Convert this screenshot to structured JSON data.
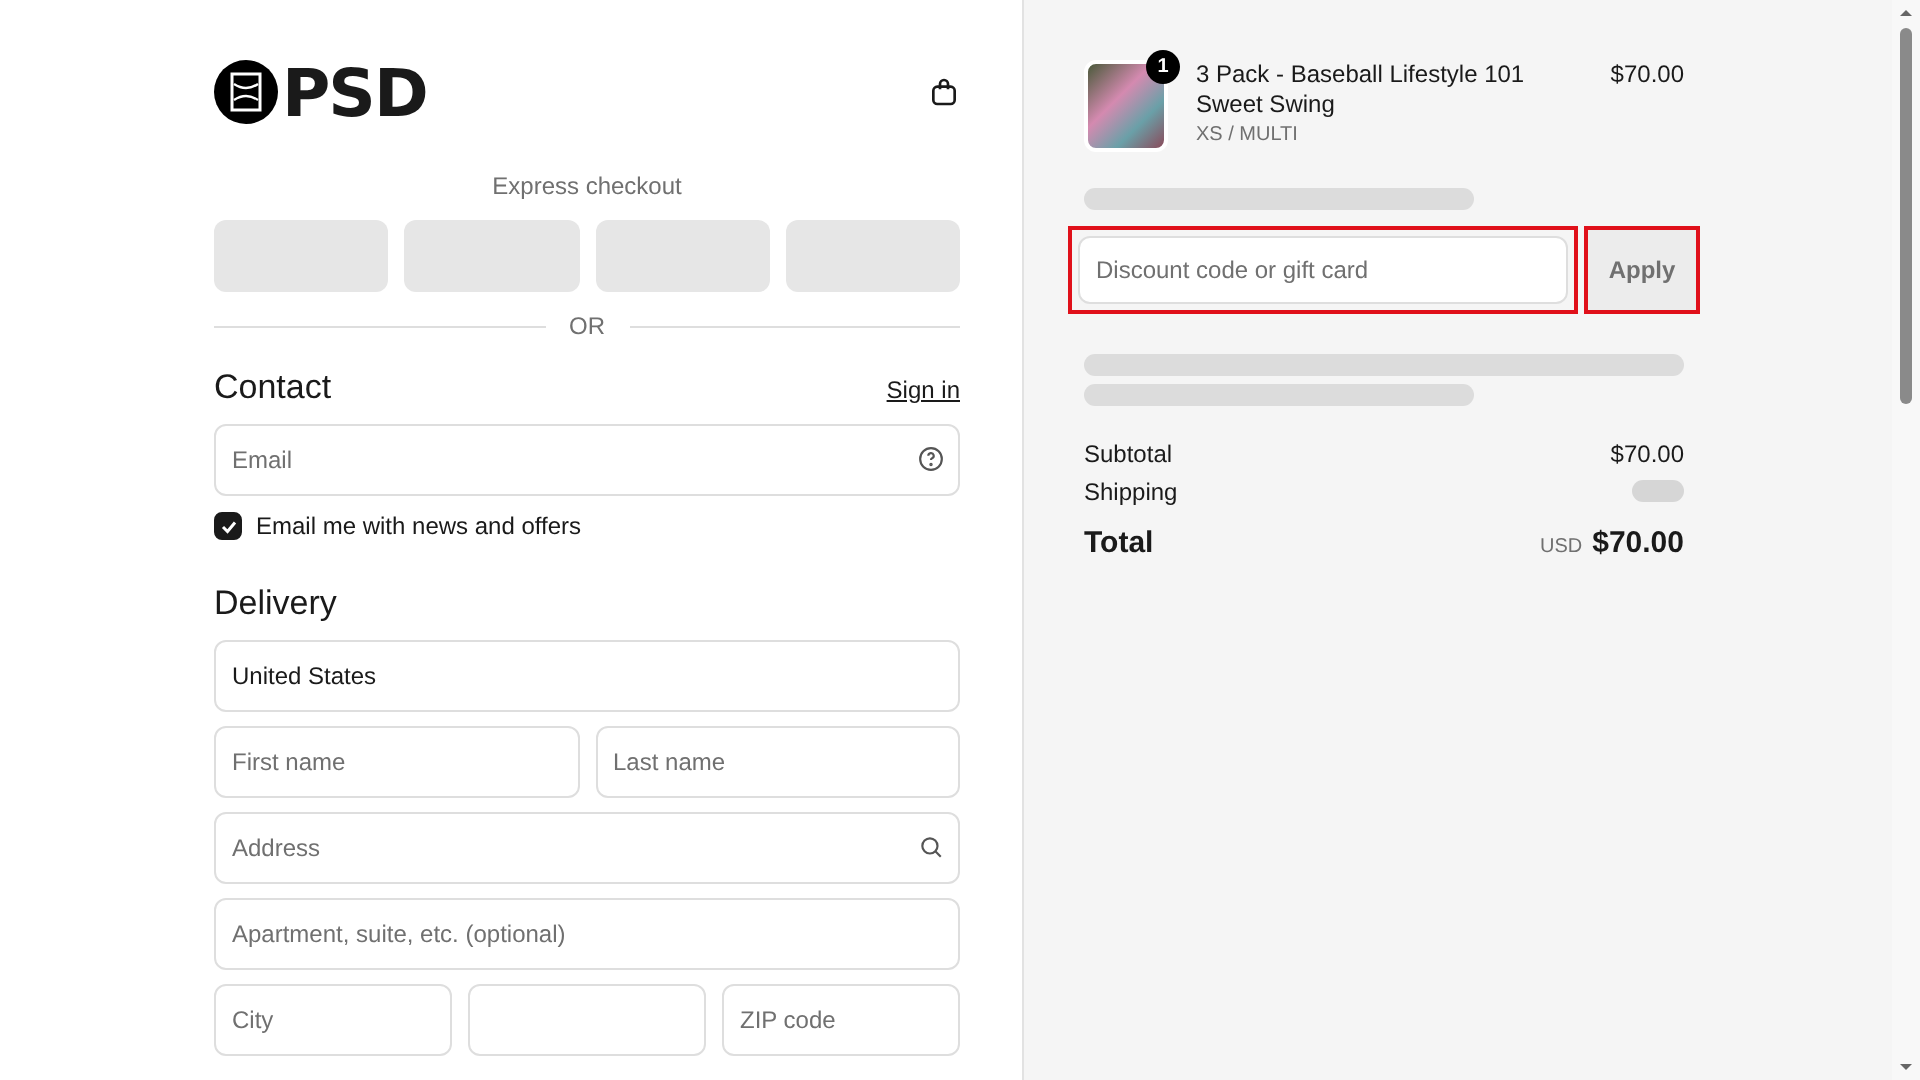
{
  "header": {
    "logo_text": "PSD"
  },
  "express_checkout": {
    "label": "Express checkout",
    "divider_label": "OR"
  },
  "contact": {
    "heading": "Contact",
    "sign_in_link": "Sign in",
    "email": {
      "placeholder": "Email"
    },
    "newsletter": {
      "label": "Email me with news and offers",
      "checked": true
    }
  },
  "delivery": {
    "heading": "Delivery",
    "country": {
      "value": "United States"
    },
    "rows": [
      {
        "fields": [
          {
            "kind": "text",
            "placeholder": "First name"
          },
          {
            "kind": "text",
            "placeholder": "Last name"
          }
        ]
      },
      {
        "fields": [
          {
            "kind": "search",
            "placeholder": "Address"
          }
        ]
      },
      {
        "fields": [
          {
            "kind": "text",
            "placeholder": "Apartment, suite, etc. (optional)"
          }
        ]
      },
      {
        "fields": [
          {
            "kind": "text",
            "placeholder": "City"
          },
          {
            "kind": "empty"
          },
          {
            "kind": "text",
            "placeholder": "ZIP code"
          }
        ]
      }
    ]
  },
  "order_summary": {
    "item": {
      "quantity": "1",
      "title": "3 Pack - Baseball Lifestyle 101 Sweet Swing",
      "variant": "XS / MULTI",
      "price": "$70.00"
    },
    "discount": {
      "placeholder": "Discount code or gift card",
      "button": "Apply",
      "highlighted": true
    },
    "lines": [
      {
        "label": "Subtotal",
        "value": "$70.00",
        "loading": false
      },
      {
        "label": "Shipping",
        "loading": true
      }
    ],
    "total": {
      "label": "Total",
      "currency": "USD",
      "value": "$70.00"
    }
  }
}
